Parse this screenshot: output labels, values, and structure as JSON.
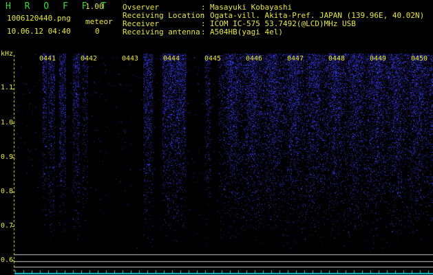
{
  "header": {
    "brand": "H R O F F T",
    "version": "1.00",
    "filename": "1006120440.png",
    "meteor_label": "meteor",
    "datetime": "10.06.12 04:40",
    "meteor_count": "0"
  },
  "info": [
    {
      "label": "Ovserver",
      "value": "Masayuki Kobayashi"
    },
    {
      "label": "Receiving Location",
      "value": "Ogata-vill. Akita-Pref. JAPAN (139.96E, 40.02N)"
    },
    {
      "label": "Receiver",
      "value": "ICOM IC-575 53.7492(@LCD)MHz USB"
    },
    {
      "label": "Receiving antenna",
      "value": "A504HB(yagi 4el)"
    }
  ],
  "info_colon": ":",
  "axis": {
    "unit": "kHz",
    "y_ticks": [
      "1.1",
      "1.0",
      "0.9",
      "0.8",
      "0.7",
      "0.6"
    ],
    "time_labels": [
      "0441",
      "0442",
      "0443",
      "0444",
      "0445",
      "0446",
      "0447",
      "0448",
      "0449",
      "0450"
    ]
  },
  "colors": {
    "background": "#000000",
    "signal": "#3a3aff",
    "text_yellow": "#e8e840",
    "text_green": "#38d838",
    "gridline": "#c8c8c8",
    "baseline": "#22c8d8"
  }
}
